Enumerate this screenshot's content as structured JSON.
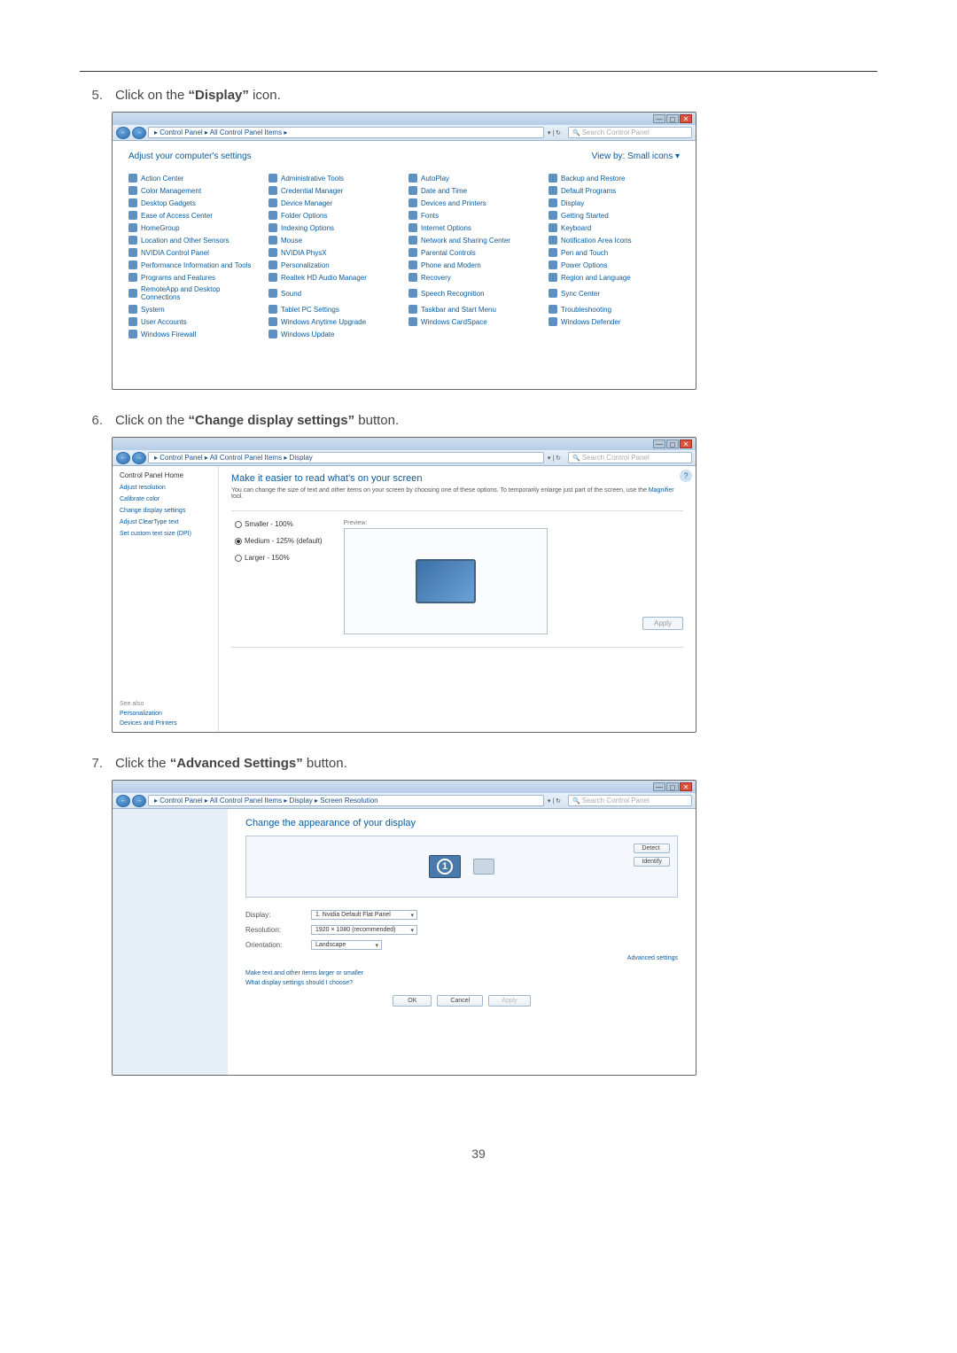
{
  "page_number": "39",
  "step5": {
    "num": "5.",
    "text_prefix": "Click on the ",
    "bold": "“Display”",
    "text_suffix": " icon.",
    "titlebar": {
      "min": "—",
      "max": "◻",
      "close": "✕"
    },
    "nav_back": "←",
    "nav_fwd": "→",
    "path": "▸ Control Panel ▸ All Control Panel Items ▸",
    "addr_ext": "▾ | ↻",
    "search_placeholder": "Search Control Panel",
    "heading_left": "Adjust your computer's settings",
    "heading_right": "View by: Small icons ▾",
    "items": [
      "Action Center",
      "Administrative Tools",
      "AutoPlay",
      "Backup and Restore",
      "Color Management",
      "Credential Manager",
      "Date and Time",
      "Default Programs",
      "Desktop Gadgets",
      "Device Manager",
      "Devices and Printers",
      "Display",
      "Ease of Access Center",
      "Folder Options",
      "Fonts",
      "Getting Started",
      "HomeGroup",
      "Indexing Options",
      "Internet Options",
      "Keyboard",
      "Location and Other Sensors",
      "Mouse",
      "Network and Sharing Center",
      "Notification Area Icons",
      "NVIDIA Control Panel",
      "NVIDIA PhysX",
      "Parental Controls",
      "Pen and Touch",
      "Performance Information and Tools",
      "Personalization",
      "Phone and Modem",
      "Power Options",
      "Programs and Features",
      "Realtek HD Audio Manager",
      "Recovery",
      "Region and Language",
      "RemoteApp and Desktop Connections",
      "Sound",
      "Speech Recognition",
      "Sync Center",
      "System",
      "Tablet PC Settings",
      "Taskbar and Start Menu",
      "Troubleshooting",
      "User Accounts",
      "Windows Anytime Upgrade",
      "Windows CardSpace",
      "Windows Defender",
      "Windows Firewall",
      "Windows Update"
    ]
  },
  "step6": {
    "num": "6.",
    "text_prefix": "Click on the ",
    "bold": "“Change display settings”",
    "text_suffix": " button.",
    "path": "▸ Control Panel ▸ All Control Panel Items ▸ Display",
    "search_placeholder": "Search Control Panel",
    "side": {
      "home": "Control Panel Home",
      "l1": "Adjust resolution",
      "l2": "Calibrate color",
      "l3": "Change display settings",
      "l4": "Adjust ClearType text",
      "l5": "Set custom text size (DPI)",
      "seealso": "See also",
      "s1": "Personalization",
      "s2": "Devices and Printers"
    },
    "h1": "Make it easier to read what's on your screen",
    "sub_pre": "You can change the size of text and other items on your screen by choosing one of these options. To temporarily enlarge just part of the screen, use the ",
    "sub_link": "Magnifier",
    "sub_post": " tool.",
    "opt1": "Smaller - 100%",
    "opt2": "Medium - 125% (default)",
    "opt3": "Larger - 150%",
    "preview": "Preview:",
    "apply": "Apply",
    "help": "?"
  },
  "step7": {
    "num": "7.",
    "text_prefix": "Click the ",
    "bold": "“Advanced Settings”",
    "text_suffix": " button.",
    "path": "▸ Control Panel ▸ All Control Panel Items ▸ Display ▸ Screen Resolution",
    "search_placeholder": "Search Control Panel",
    "h1": "Change the appearance of your display",
    "detect": "Detect",
    "identify": "Identify",
    "mon1": "1",
    "l_display": "Display:",
    "v_display": "1. Nvidia Default Flat Panel",
    "l_res": "Resolution:",
    "v_res": "1920 × 1080 (recommended)",
    "l_orient": "Orientation:",
    "v_orient": "Landscape",
    "adv": "Advanced settings",
    "link1": "Make text and other items larger or smaller",
    "link2": "What display settings should I choose?",
    "ok": "OK",
    "cancel": "Cancel",
    "apply": "Apply"
  }
}
